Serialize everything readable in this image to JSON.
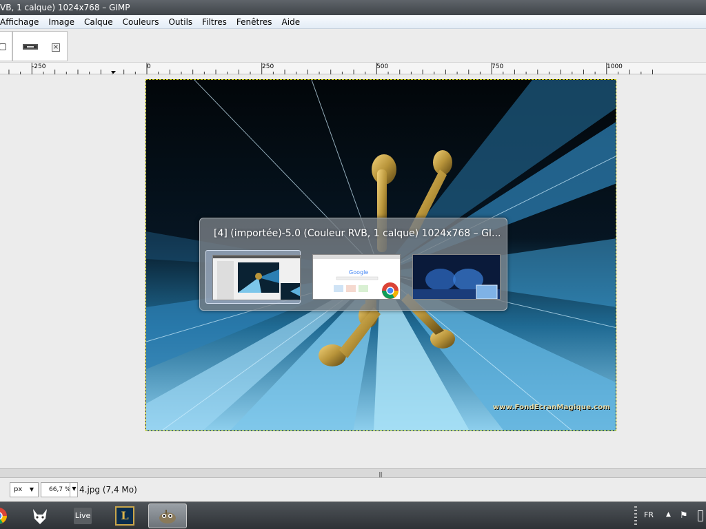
{
  "window": {
    "title": "VB, 1 calque) 1024x768 – GIMP"
  },
  "menubar": {
    "items": [
      "Affichage",
      "Image",
      "Calque",
      "Couleurs",
      "Outils",
      "Filtres",
      "Fenêtres",
      "Aide"
    ]
  },
  "tabs": {
    "close_glyph": "×"
  },
  "ruler": {
    "labels": [
      "-250",
      "0",
      "250",
      "500",
      "750",
      "1000"
    ]
  },
  "image": {
    "watermark": "www.FondEcranMagique.com"
  },
  "switcher": {
    "title": "[4] (importée)-5.0 (Couleur RVB, 1 calque) 1024x768 – GI...",
    "items": [
      {
        "name": "gimp-window",
        "selected": true
      },
      {
        "name": "chrome-window",
        "selected": false
      },
      {
        "name": "desktop",
        "selected": false
      }
    ]
  },
  "statusbar": {
    "unit": "px",
    "zoom": "66,7 %",
    "file_info": "4.jpg (7,4 Mo)"
  },
  "taskbar": {
    "live_label": "Live",
    "lol_label": "L",
    "language": "FR"
  },
  "colors": {
    "accent_blue": "#3a8fc8",
    "gold": "#b8943a",
    "selection_dash": "#c9c900"
  }
}
